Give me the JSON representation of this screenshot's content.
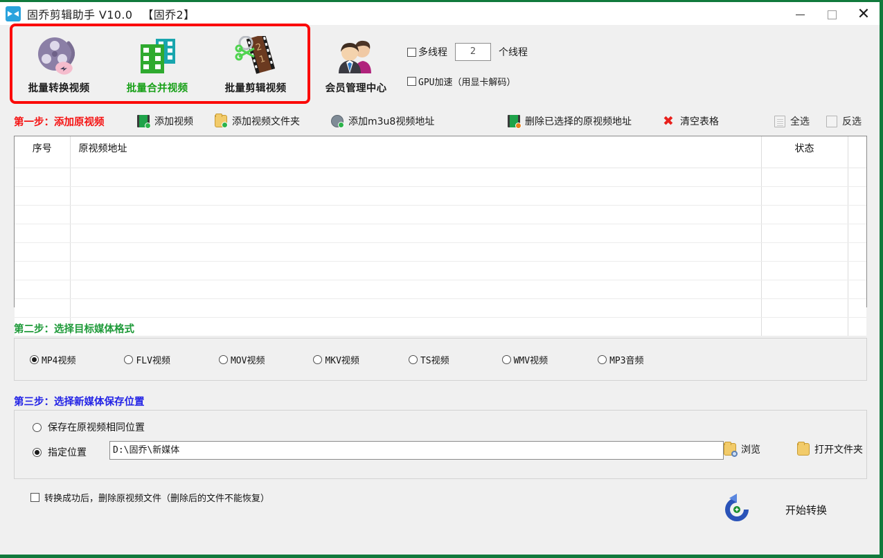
{
  "window": {
    "title": "固乔剪辑助手 V10.0 　【固乔2】",
    "app_icon": "video-app-icon",
    "minimize_label": "—",
    "maximize_label": "□",
    "close_label": "✕",
    "border_color": "#107a3c",
    "highlight_color": "#fb0a08"
  },
  "toolbar": {
    "buttons": [
      {
        "label": "批量转换视频",
        "icon": "film-reel-icon",
        "active": false
      },
      {
        "label": "批量合并视频",
        "icon": "merge-video-icon",
        "active": true
      },
      {
        "label": "批量剪辑视频",
        "icon": "scissors-film-icon",
        "active": false
      },
      {
        "label": "会员管理中心",
        "icon": "members-icon",
        "active": false
      }
    ],
    "options": {
      "multithread_label": "多线程",
      "multithread_checked": false,
      "thread_count": "2",
      "thread_unit": "个线程",
      "gpu_label": "GPU加速（用显卡解码）",
      "gpu_checked": false
    }
  },
  "step1": {
    "label": "第一步：添加原视频",
    "actions": [
      {
        "label": "添加视频",
        "icon": "add-video-icon"
      },
      {
        "label": "添加视频文件夹",
        "icon": "add-folder-icon"
      },
      {
        "label": "添加m3u8视频地址",
        "icon": "add-m3u8-icon"
      },
      {
        "label": "删除已选择的原视频地址",
        "icon": "delete-video-icon"
      },
      {
        "label": "清空表格",
        "icon": "clear-table-icon"
      },
      {
        "label": "全选",
        "icon": "select-all-icon"
      },
      {
        "label": "反选",
        "icon": "invert-selection-icon"
      }
    ]
  },
  "table": {
    "columns": [
      "序号",
      "原视频地址",
      "状态"
    ],
    "rows": [],
    "empty_row_count": 9
  },
  "step2": {
    "label": "第二步：选择目标媒体格式",
    "formats": [
      {
        "label": "MP4视频",
        "selected": true
      },
      {
        "label": "FLV视频",
        "selected": false
      },
      {
        "label": "MOV视频",
        "selected": false
      },
      {
        "label": "MKV视频",
        "selected": false
      },
      {
        "label": "TS视频",
        "selected": false
      },
      {
        "label": "WMV视频",
        "selected": false
      },
      {
        "label": "MP3音频",
        "selected": false
      }
    ]
  },
  "step3": {
    "label": "第三步：选择新媒体保存位置",
    "same_location_label": "保存在原视频相同位置",
    "same_location_selected": false,
    "specify_location_label": "指定位置",
    "specify_location_selected": true,
    "path_value": "D:\\固乔\\新媒体",
    "browse_label": "浏览",
    "browse_icon": "browse-folder-icon",
    "open_folder_label": "打开文件夹",
    "open_folder_icon": "open-folder-icon"
  },
  "footer": {
    "delete_after_label": "转换成功后，删除原视频文件（删除后的文件不能恢复）",
    "delete_after_checked": false,
    "start_label": "开始转换",
    "start_icon": "refresh-convert-icon"
  }
}
